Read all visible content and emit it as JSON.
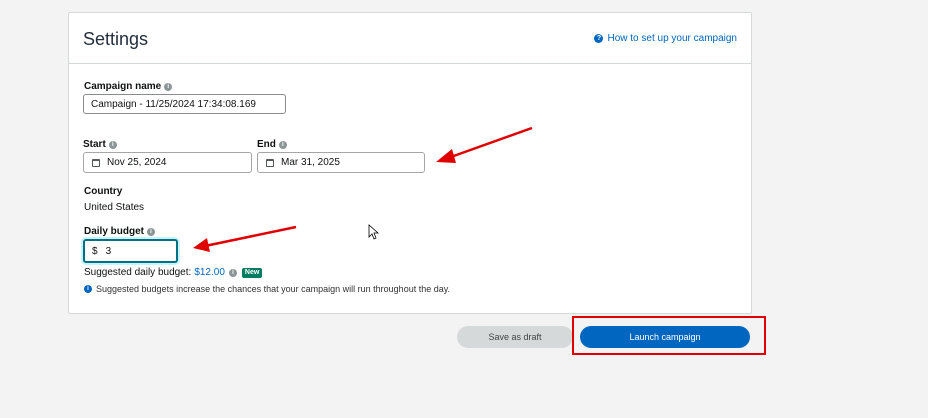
{
  "settings": {
    "title": "Settings",
    "help_link": "How to set up your campaign",
    "campaign_name_label": "Campaign name",
    "campaign_name_value": "Campaign - 11/25/2024 17:34:08.169",
    "start_label": "Start",
    "start_value": "Nov 25, 2024",
    "end_label": "End",
    "end_value": "Mar 31, 2025",
    "country_label": "Country",
    "country_value": "United States",
    "daily_budget_label": "Daily budget",
    "currency_symbol": "$",
    "daily_budget_value": "3",
    "suggested_label": "Suggested daily budget:",
    "suggested_amount": "$12.00",
    "new_badge": "New",
    "suggestion_note": "Suggested budgets increase the chances that your campaign will run throughout the day."
  },
  "actions": {
    "save_draft": "Save as draft",
    "launch": "Launch campaign"
  },
  "colors": {
    "accent": "#0066c0",
    "annotation": "#e00000"
  }
}
